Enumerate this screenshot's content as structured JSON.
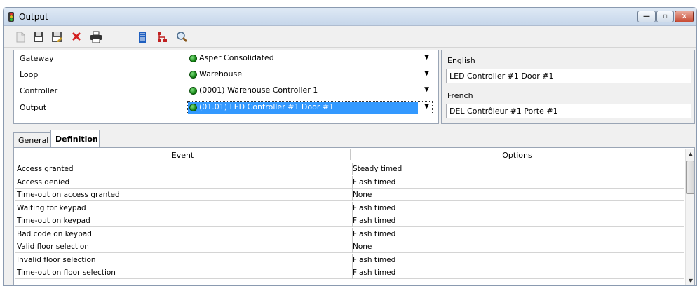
{
  "window": {
    "title": "Output",
    "controls": {
      "minimize_icon": "minimize-icon",
      "maximize_icon": "maximize-icon",
      "close_icon": "close-icon"
    }
  },
  "toolbar": {
    "buttons": [
      {
        "name": "new-button",
        "icon": "new-document-icon",
        "enabled": false
      },
      {
        "name": "save-button",
        "icon": "floppy-disk-icon",
        "enabled": true
      },
      {
        "name": "save-as-button",
        "icon": "floppy-disk-edit-icon",
        "enabled": true
      },
      {
        "name": "delete-button",
        "icon": "red-x-icon",
        "enabled": true
      },
      {
        "name": "print-button",
        "icon": "printer-icon",
        "enabled": true
      },
      {
        "name": "list-button",
        "icon": "list-icon",
        "enabled": true
      },
      {
        "name": "tree-button",
        "icon": "hierarchy-icon",
        "enabled": true
      },
      {
        "name": "search-button",
        "icon": "magnifier-icon",
        "enabled": true
      }
    ]
  },
  "form": {
    "fields": [
      {
        "label": "Gateway",
        "value": "Asper Consolidated",
        "selected": false
      },
      {
        "label": "Loop",
        "value": "Warehouse",
        "selected": false
      },
      {
        "label": "Controller",
        "value": "(0001) Warehouse Controller 1",
        "selected": false
      },
      {
        "label": "Output",
        "value": "(01.01) LED Controller #1 Door #1",
        "selected": true
      }
    ]
  },
  "languages": {
    "english_label": "English",
    "english_value": "LED Controller #1 Door #1",
    "french_label": "French",
    "french_value": "DEL Contrôleur #1 Porte #1"
  },
  "tabs": [
    {
      "label": "General",
      "active": false
    },
    {
      "label": "Definition",
      "active": true
    }
  ],
  "grid": {
    "columns": [
      "Event",
      "Options"
    ],
    "rows": [
      {
        "event": "Access granted",
        "option": "Steady timed"
      },
      {
        "event": "Access denied",
        "option": "Flash timed"
      },
      {
        "event": "Time-out on access granted",
        "option": "None"
      },
      {
        "event": "Waiting for keypad",
        "option": "Flash timed"
      },
      {
        "event": "Time-out on keypad",
        "option": "Flash timed"
      },
      {
        "event": "Bad code on keypad",
        "option": "Flash timed"
      },
      {
        "event": "Valid floor selection",
        "option": "None"
      },
      {
        "event": "Invalid floor selection",
        "option": "Flash timed"
      },
      {
        "event": "Time-out on floor selection",
        "option": "Flash timed"
      }
    ]
  },
  "colors": {
    "selection": "#3399ff",
    "status_dot": "#1a9a1a",
    "delete_red": "#d42020"
  }
}
